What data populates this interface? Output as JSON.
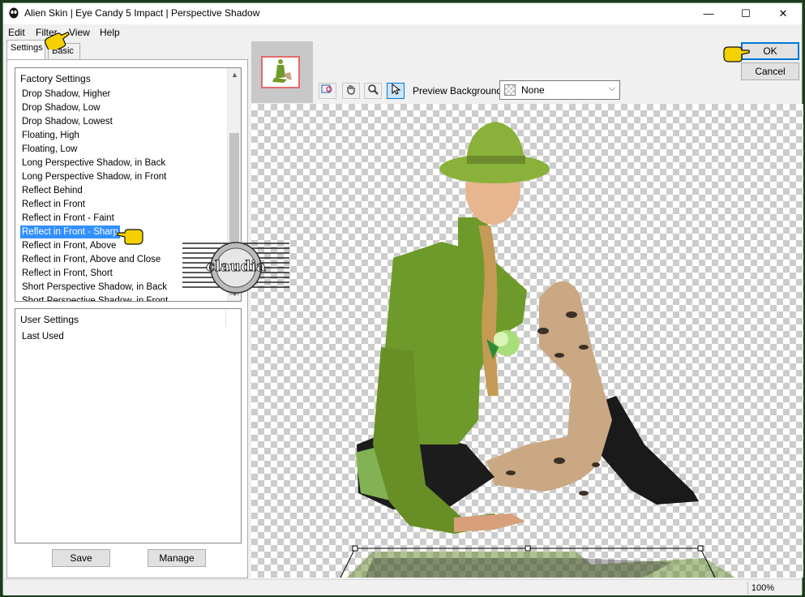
{
  "window": {
    "title": "Alien Skin | Eye Candy 5 Impact | Perspective Shadow",
    "minimize_glyph": "—",
    "maximize_glyph": "☐",
    "close_glyph": "✕"
  },
  "menu": [
    "Edit",
    "Filter",
    "View",
    "Help"
  ],
  "tabs": {
    "settings": "Settings",
    "basic": "Basic"
  },
  "factory": {
    "header": "Factory Settings",
    "items": [
      "Drop Shadow, Higher",
      "Drop Shadow, Low",
      "Drop Shadow, Lowest",
      "Floating, High",
      "Floating, Low",
      "Long Perspective Shadow, in Back",
      "Long Perspective Shadow, in Front",
      "Reflect Behind",
      "Reflect in Front",
      "Reflect in Front - Faint",
      "Reflect in Front - Sharp",
      "Reflect in Front, Above",
      "Reflect in Front, Above and Close",
      "Reflect in Front, Short",
      "Short Perspective Shadow, in Back",
      "Short Perspective Shadow, in Front"
    ],
    "selected_item": "Reflect in Front - Sharp"
  },
  "user_settings": {
    "header": "User Settings",
    "items": [
      "Last Used"
    ]
  },
  "buttons": {
    "save": "Save",
    "manage": "Manage",
    "ok": "OK",
    "cancel": "Cancel"
  },
  "preview_background": {
    "label": "Preview Background:",
    "value": "None"
  },
  "watermark": {
    "text": "claudia"
  },
  "status": {
    "zoom": "100%"
  },
  "tools": [
    "zoom-fit-icon",
    "hand-icon",
    "magnifier-icon",
    "pointer-icon"
  ]
}
